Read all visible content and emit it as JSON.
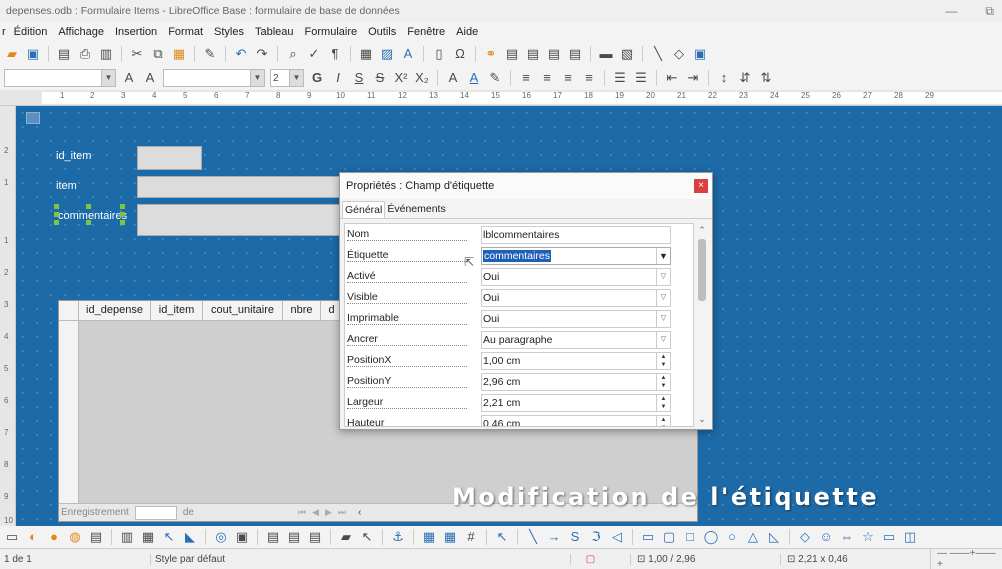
{
  "window": {
    "title": "depenses.odb : Formulaire Items - LibreOffice Base : formulaire de base de données",
    "minimize_glyph": "—",
    "restore_glyph": "⧉"
  },
  "menu": [
    "Édition",
    "Affichage",
    "Insertion",
    "Format",
    "Styles",
    "Tableau",
    "Formulaire",
    "Outils",
    "Fenêtre",
    "Aide"
  ],
  "menu_cut": "r",
  "toolbar": {
    "font_size": "2"
  },
  "ruler_numbers": [
    "1",
    "2",
    "3",
    "4",
    "5",
    "6",
    "7",
    "8",
    "9",
    "10",
    "11",
    "12",
    "13",
    "14",
    "15",
    "16",
    "17",
    "18",
    "19",
    "20",
    "21",
    "22",
    "23",
    "24",
    "25",
    "26",
    "27",
    "28",
    "29"
  ],
  "form": {
    "labels": {
      "id_item": "id_item",
      "item": "item",
      "commentaires": "commentaires"
    },
    "grid_columns": [
      "id_depense",
      "id_item",
      "cout_unitaire",
      "nbre",
      "d"
    ],
    "nav_record_label": "Enregistrement",
    "nav_of": "de"
  },
  "dialog": {
    "title": "Propriétés : Champ d'étiquette",
    "close": "×",
    "tabs": [
      "Général",
      "Événements"
    ],
    "properties": [
      {
        "label": "Nom",
        "value": "lblcommentaires",
        "control": "text"
      },
      {
        "label": "Étiquette",
        "value": "commentaires",
        "control": "dropdown-selected"
      },
      {
        "label": "Activé",
        "value": "Oui",
        "control": "dropdown"
      },
      {
        "label": "Visible",
        "value": "Oui",
        "control": "dropdown"
      },
      {
        "label": "Imprimable",
        "value": "Oui",
        "control": "dropdown"
      },
      {
        "label": "Ancrer",
        "value": "Au paragraphe",
        "control": "dropdown"
      },
      {
        "label": "PositionX",
        "value": "1,00 cm",
        "control": "spin"
      },
      {
        "label": "PositionY",
        "value": "2,96 cm",
        "control": "spin"
      },
      {
        "label": "Largeur",
        "value": "2,21 cm",
        "control": "spin"
      },
      {
        "label": "Hauteur",
        "value": "0,46 cm",
        "control": "spin"
      }
    ]
  },
  "caption": "Modification de l'étiquette",
  "status": {
    "page": "1 de 1",
    "style": "Style par défaut",
    "position": "1,00 / 2,96",
    "size": "2,21 x 0,46"
  }
}
